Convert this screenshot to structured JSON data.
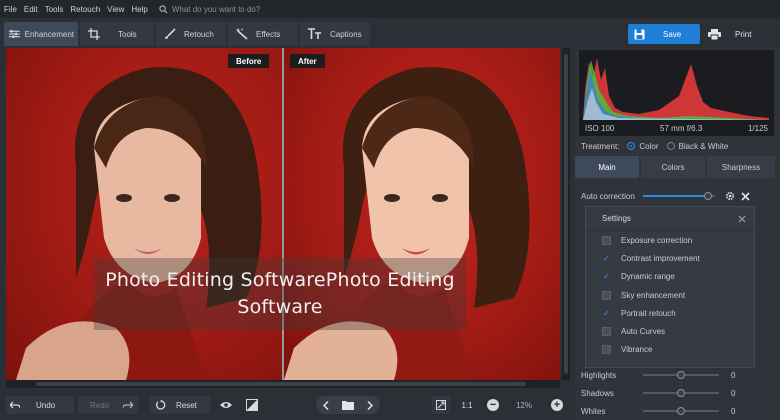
{
  "menu": [
    "File",
    "Edit",
    "Tools",
    "Retouch",
    "View",
    "Help"
  ],
  "search": {
    "placeholder": "What do you want to do?"
  },
  "tabs": [
    {
      "label": "Enhancement",
      "icon": "sliders-icon"
    },
    {
      "label": "Tools",
      "icon": "crop-icon"
    },
    {
      "label": "Retouch",
      "icon": "brush-icon"
    },
    {
      "label": "Effects",
      "icon": "magic-wand-icon"
    },
    {
      "label": "Captions",
      "icon": "text-icon"
    }
  ],
  "actions": {
    "save": "Save",
    "print": "Print"
  },
  "preview": {
    "before_label": "Before",
    "after_label": "After",
    "watermark": "Photo Editing SoftwarePhoto Editing Software"
  },
  "bottom": {
    "undo": "Undo",
    "redo": "Redo",
    "reset": "Reset",
    "one_to_one": "1:1",
    "zoom": "12%"
  },
  "exif": {
    "iso": "ISO 100",
    "lens": "57 mm f/6.3",
    "shutter": "1/125"
  },
  "treatment": {
    "label": "Treatment:",
    "options": [
      "Color",
      "Black & White"
    ],
    "selected": "Color"
  },
  "panel_tabs": [
    "Main",
    "Colors",
    "Sharpness"
  ],
  "auto_correction": {
    "label": "Auto correction",
    "level": 0.9
  },
  "settings": {
    "title": "Settings",
    "options": [
      {
        "label": "Exposure correction",
        "checked": false
      },
      {
        "label": "Contrast improvement",
        "checked": true
      },
      {
        "label": "Dynamic range",
        "checked": true
      },
      {
        "label": "Sky enhancement",
        "checked": false
      },
      {
        "label": "Portrait retouch",
        "checked": true
      },
      {
        "label": "Auto Curves",
        "checked": false
      },
      {
        "label": "Vibrance",
        "checked": false
      }
    ]
  },
  "adjustments": [
    {
      "label": "Highlights",
      "value": "0"
    },
    {
      "label": "Shadows",
      "value": "0"
    },
    {
      "label": "Whites",
      "value": "0"
    }
  ],
  "colors": {
    "accent": "#1f7ed6",
    "background": "#2b2f36",
    "panel": "#2f333a"
  }
}
